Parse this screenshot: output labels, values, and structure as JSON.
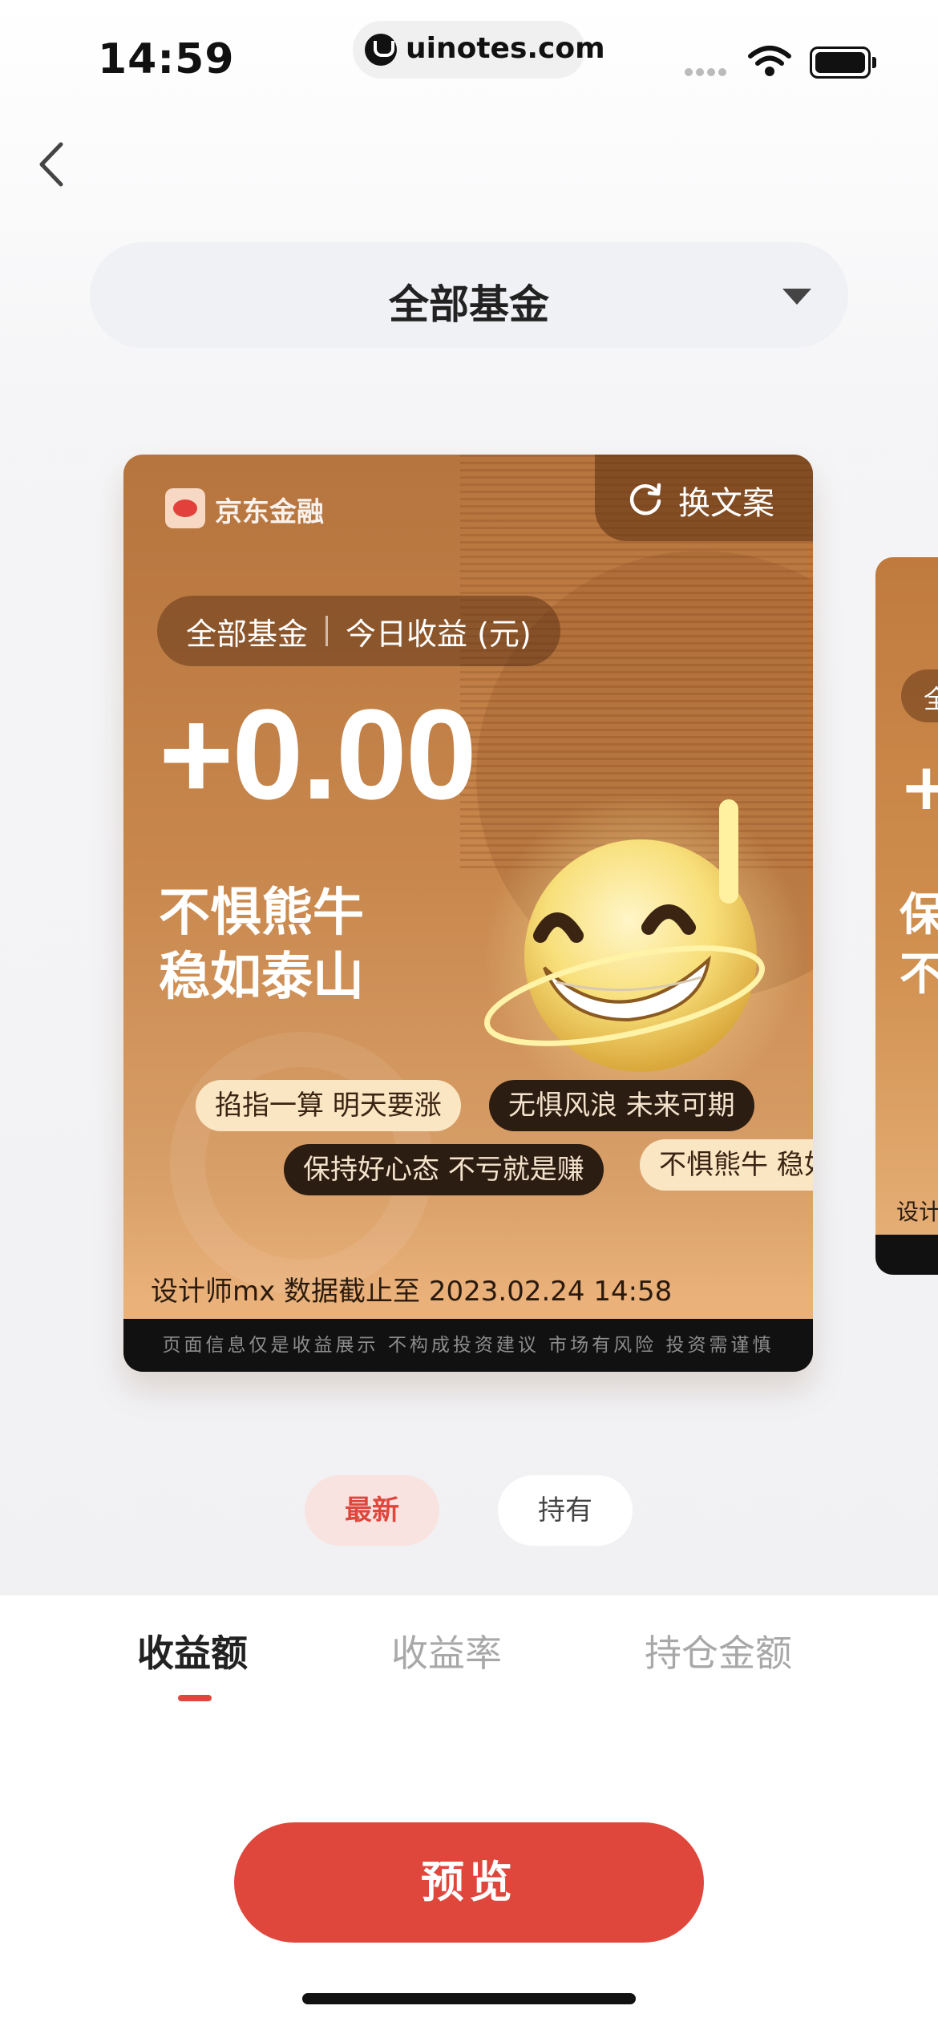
{
  "status_bar": {
    "time": "14:59",
    "url": "uinotes.com"
  },
  "fund_selector": {
    "label": "全部基金"
  },
  "card": {
    "brand": "京东金融",
    "refresh_label": "换文案",
    "fund_name": "全部基金",
    "metric_label": "今日收益 (元)",
    "amount": "+0.00",
    "slogan_line1": "不惧熊牛",
    "slogan_line2": "稳如泰山",
    "chips": [
      "掐指一算 明天要涨",
      "无惧风浪 未来可期",
      "保持好心态 不亏就是赚",
      "不惧熊牛 稳如"
    ],
    "footer": "设计师mx 数据截止至 2023.02.24 14:58",
    "disclaimer": "页面信息仅是收益展示 不构成投资建议 市场有风险 投资需谨慎"
  },
  "peek_card": {
    "pill": "全",
    "plus": "+",
    "line1": "保",
    "line2": "不",
    "footer": "设计"
  },
  "segments": {
    "latest": "最新",
    "holding": "持有"
  },
  "tabs": {
    "t1": "收益额",
    "t2": "收益率",
    "t3": "持仓金额"
  },
  "preview_button": "预览",
  "colors": {
    "accent": "#e0473c",
    "card_brown": "#c8874c"
  }
}
